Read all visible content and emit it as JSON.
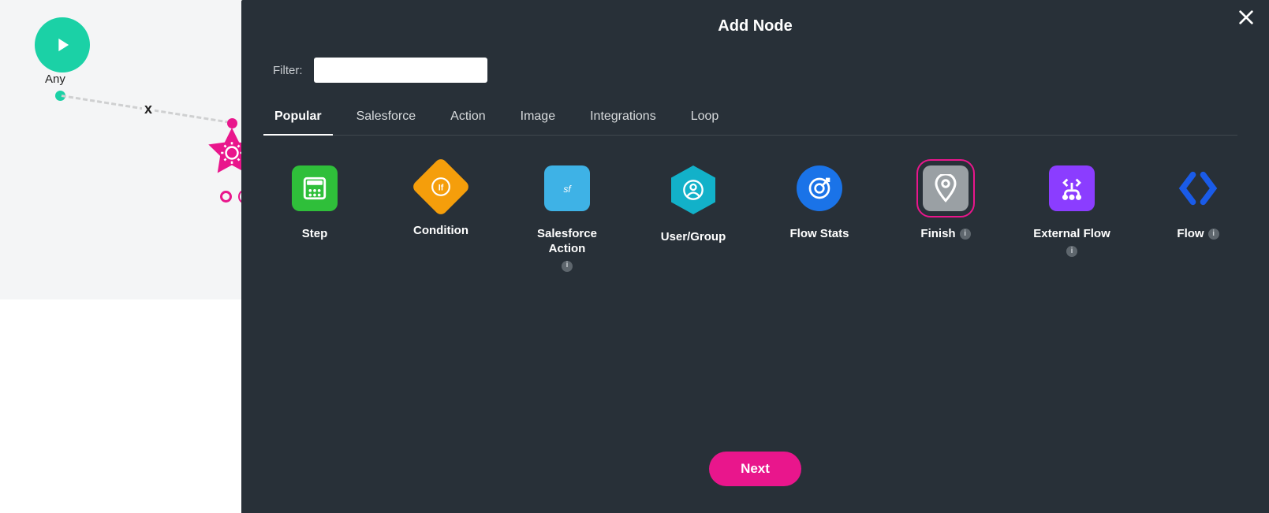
{
  "canvas": {
    "play_label": "Any",
    "connection_x": "x"
  },
  "panel": {
    "title": "Add Node",
    "filter_label": "Filter:",
    "filter_value": "",
    "tabs": [
      "Popular",
      "Salesforce",
      "Action",
      "Image",
      "Integrations",
      "Loop"
    ],
    "active_tab": "Popular",
    "tiles": [
      {
        "label": "Step",
        "info": false,
        "selected": false,
        "icon": "grid",
        "style": "box",
        "color": "c-green"
      },
      {
        "label": "Condition",
        "info": false,
        "selected": false,
        "icon": "if",
        "style": "diamond",
        "color": "c-orange"
      },
      {
        "label": "Salesforce Action",
        "info": true,
        "selected": false,
        "icon": "cloud",
        "style": "box",
        "color": "c-sky"
      },
      {
        "label": "User/Group",
        "info": false,
        "selected": false,
        "icon": "user",
        "style": "hex",
        "color": "c-cyan"
      },
      {
        "label": "Flow Stats",
        "info": false,
        "selected": false,
        "icon": "target",
        "style": "circle",
        "color": "c-blue"
      },
      {
        "label": "Finish",
        "info": true,
        "selected": true,
        "icon": "pin",
        "style": "box",
        "color": "c-grey"
      },
      {
        "label": "External Flow",
        "info": true,
        "selected": false,
        "icon": "splitout",
        "style": "box",
        "color": "c-purple"
      },
      {
        "label": "Flow",
        "info": true,
        "selected": false,
        "icon": "brackets",
        "style": "plain",
        "color": ""
      }
    ],
    "next_label": "Next"
  }
}
